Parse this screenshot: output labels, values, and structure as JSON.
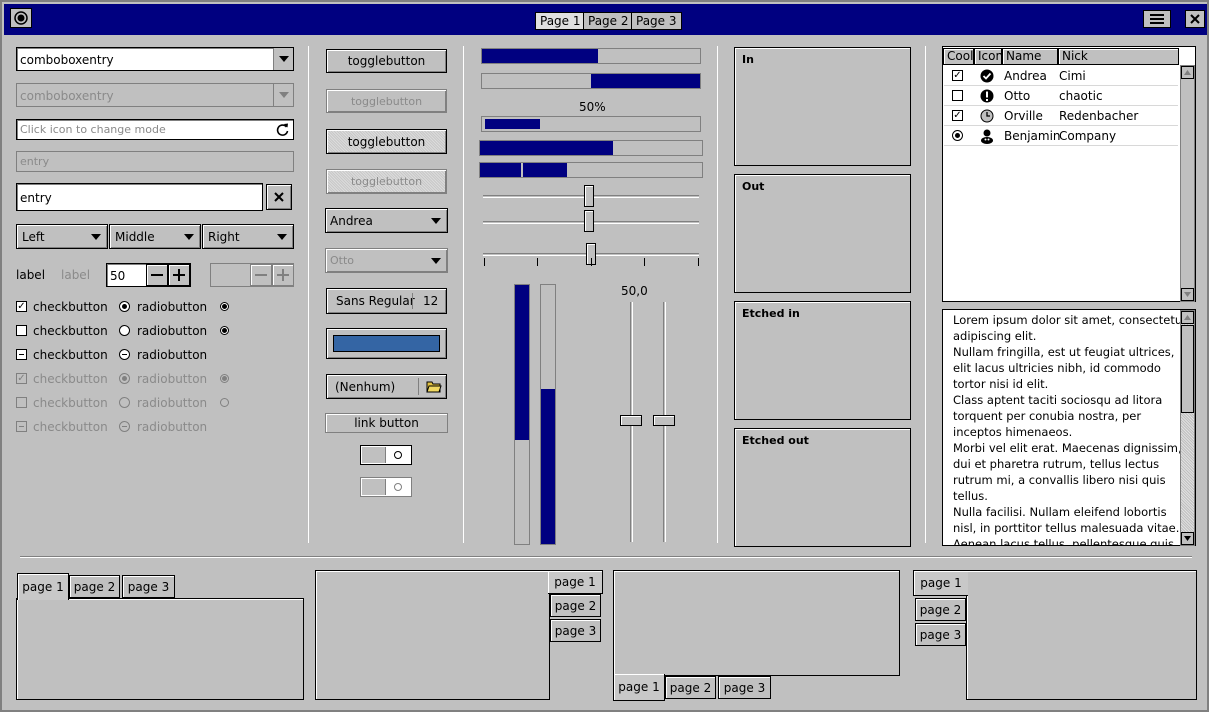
{
  "titlebar": {
    "tabs": [
      "Page 1",
      "Page 2",
      "Page 3"
    ],
    "menu_icon": "hamburger-icon",
    "close_icon": "close-icon",
    "app_icon": "record-icon",
    "bg_color": "#000080"
  },
  "col1": {
    "combo1": "comboboxentry",
    "combo2": "comboboxentry",
    "entry_placeholder": "Click icon to change mode",
    "entry_disabled": "entry",
    "entry": "entry",
    "dropdowns": [
      "Left",
      "Middle",
      "Right"
    ],
    "label1": "label",
    "label2": "label",
    "spin_value": "50",
    "checks": [
      "checkbutton",
      "checkbutton",
      "checkbutton",
      "checkbutton",
      "checkbutton",
      "checkbutton"
    ],
    "radios": [
      "radiobutton",
      "radiobutton",
      "radiobutton",
      "radiobutton",
      "radiobutton",
      "radiobutton"
    ]
  },
  "col2": {
    "toggles": [
      "togglebutton",
      "togglebutton",
      "togglebutton",
      "togglebutton"
    ],
    "combo_andrea": "Andrea",
    "combo_otto": "Otto",
    "font_name": "Sans Regular",
    "font_size": "12",
    "color_swatch": "#3465a4",
    "file_chooser": "(Nenhum)",
    "link_button": "link button"
  },
  "col3": {
    "progress_label": "50%",
    "scale_label": "50,0",
    "progress": [
      0.53,
      0.5,
      0.25,
      0.6,
      0.4
    ],
    "vprogress": [
      0.6,
      0.6
    ]
  },
  "frames": [
    "In",
    "Out",
    "Etched in",
    "Etched out"
  ],
  "tree": {
    "headers": [
      "Cool",
      "Icon",
      "Name",
      "Nick"
    ],
    "rows": [
      {
        "cool": "checked",
        "icon": "check-circle-icon",
        "name": "Andrea",
        "nick": "Cimi"
      },
      {
        "cool": "unchecked",
        "icon": "warning-icon",
        "name": "Otto",
        "nick": "chaotic"
      },
      {
        "cool": "checked",
        "icon": "clock-icon",
        "name": "Orville",
        "nick": "Redenbacher"
      },
      {
        "cool": "radio",
        "icon": "person-icon",
        "name": "Benjamin",
        "nick": "Company"
      }
    ]
  },
  "textview": {
    "lines": [
      "Lorem ipsum dolor sit amet, consectetur",
      "adipiscing elit.",
      "Nullam fringilla, est ut feugiat ultrices,",
      "elit lacus ultricies nibh, id commodo",
      "tortor nisi id elit.",
      "Class aptent taciti sociosqu ad litora",
      "torquent per conubia nostra, per",
      "inceptos himenaeos.",
      "Morbi vel elit erat. Maecenas dignissim,",
      "dui et pharetra rutrum, tellus lectus",
      "rutrum mi, a convallis libero nisi quis",
      "tellus.",
      "Nulla facilisi. Nullam eleifend lobortis",
      "nisl, in porttitor tellus malesuada vitae.",
      "Aenean lacus tellus, pellentesque quis"
    ]
  },
  "notebooks": {
    "tabs": [
      "page 1",
      "page 2",
      "page 3"
    ]
  }
}
